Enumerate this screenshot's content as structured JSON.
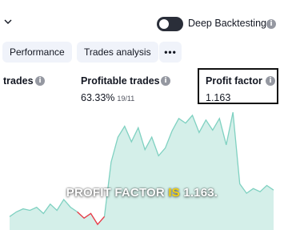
{
  "header": {
    "collapse_icon": "chevron-down-icon",
    "deep_backtesting_label": "Deep Backtesting",
    "deep_backtesting_enabled": false
  },
  "tabs": [
    {
      "label": "Performance"
    },
    {
      "label": "Trades analysis"
    },
    {
      "label": "•••"
    }
  ],
  "metrics": [
    {
      "title": "trades",
      "value": ""
    },
    {
      "title": "Profitable trades",
      "value": "63.33%",
      "sub": "19/11"
    },
    {
      "title": "Profit factor",
      "value": "1.163"
    }
  ],
  "equity_chart": {
    "type": "area",
    "values": [
      10,
      16,
      20,
      18,
      22,
      14,
      26,
      18,
      32,
      22,
      16,
      8,
      14,
      0,
      10,
      80,
      112,
      126,
      106,
      124,
      96,
      112,
      88,
      98,
      120,
      136,
      130,
      140,
      118,
      134,
      121,
      136,
      102,
      144,
      52,
      40,
      46,
      42,
      50,
      44
    ],
    "colors": {
      "fill": "#d4efe9",
      "line": "#7fd1c1",
      "negative": "#f23645"
    }
  },
  "caption": {
    "part1": "PROFIT FACTOR ",
    "part2": "IS",
    "part3": " 1.163."
  }
}
